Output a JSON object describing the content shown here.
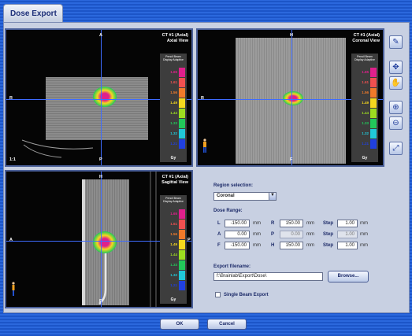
{
  "window": {
    "tab_title": "Dose Export"
  },
  "viewports": {
    "axial": {
      "title_line1": "CT #1 (Axial)",
      "title_line2": "Axial View",
      "top": "A",
      "bottom": "P",
      "left": "R",
      "right": "L",
      "corner_label": "1:1"
    },
    "coronal": {
      "title_line1": "CT #1 (Axial)",
      "title_line2": "Coronal View",
      "top": "H",
      "bottom": "F",
      "left": "R",
      "right": "L"
    },
    "sagittal": {
      "title_line1": "CT #1 (Axial)",
      "title_line2": "Sagittal View",
      "top": "H",
      "bottom": "F",
      "left": "A",
      "right": "P"
    }
  },
  "colorbar": {
    "header_line1": "Pencil Beam",
    "header_line2": "Display Adaptive",
    "unit": "Gy",
    "entries": [
      {
        "label": "1.65",
        "color": "#e0208c"
      },
      {
        "label": "1.61",
        "color": "#f05050"
      },
      {
        "label": "1.56",
        "color": "#f07a2a"
      },
      {
        "label": "1.49",
        "color": "#f4d81e"
      },
      {
        "label": "1.44",
        "color": "#9ddc20"
      },
      {
        "label": "1.33",
        "color": "#22c85a"
      },
      {
        "label": "1.32",
        "color": "#20c8d8"
      },
      {
        "label": "1.21",
        "color": "#2040e0"
      }
    ]
  },
  "sidebar_icons": [
    "edit-icon",
    "move-icon",
    "hand-icon",
    "zoom-in-icon",
    "zoom-out-icon",
    "fit-icon"
  ],
  "form": {
    "region_label": "Region selection:",
    "region_value": "Coronal",
    "dose_range_label": "Dose Range:",
    "rows": [
      {
        "a": "L",
        "a_val": "-150.00",
        "b": "R",
        "b_val": "150.00",
        "step_label": "Step",
        "step_val": "1.00",
        "unit": "mm"
      },
      {
        "a": "A",
        "a_val": "0.00",
        "b": "P",
        "b_val": "0.00",
        "step_label": "Step",
        "step_val": "1.00",
        "unit": "mm"
      },
      {
        "a": "F",
        "a_val": "-150.00",
        "b": "H",
        "b_val": "150.00",
        "step_label": "Step",
        "step_val": "1.00",
        "unit": "mm"
      }
    ],
    "export_filename_label": "Export filename:",
    "export_filename_value": "f:\\Brainlab\\Export\\Dose\\",
    "browse_label": "Browse...",
    "single_beam_label": "Single Beam Export"
  },
  "footer": {
    "ok_label": "OK",
    "cancel_label": "Cancel"
  }
}
